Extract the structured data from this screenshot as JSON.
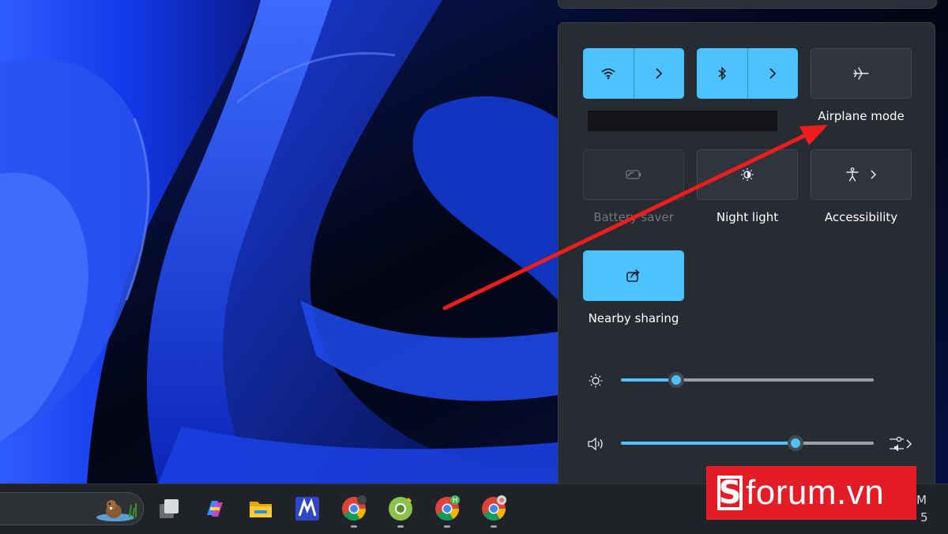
{
  "wallpaper": {
    "name": "windows-bloom-wallpaper"
  },
  "quick_settings": {
    "tiles": [
      {
        "id": "wifi",
        "label": "",
        "state": "on",
        "icon": "wifi-icon",
        "expand_icon": "chevron-right-icon"
      },
      {
        "id": "bluetooth",
        "label": "",
        "state": "on",
        "icon": "bluetooth-icon",
        "expand_icon": "chevron-right-icon"
      },
      {
        "id": "airplane",
        "label": "Airplane mode",
        "state": "off",
        "icon": "airplane-icon"
      },
      {
        "id": "battery",
        "label": "Battery saver",
        "state": "disabled",
        "icon": "battery-saver-icon"
      },
      {
        "id": "night",
        "label": "Night light",
        "state": "off",
        "icon": "night-light-icon"
      },
      {
        "id": "accessibility",
        "label": "Accessibility",
        "state": "off",
        "icon": "accessibility-icon",
        "expand_icon": "chevron-right-icon"
      },
      {
        "id": "nearby",
        "label": "Nearby sharing",
        "state": "on",
        "icon": "share-icon"
      }
    ],
    "brightness": {
      "icon": "brightness-icon",
      "level": 0.22
    },
    "volume": {
      "icon": "speaker-icon",
      "level": 0.69,
      "settings_icon": "audio-output-icon"
    },
    "accent_color": "#4cc2ff"
  },
  "annotation": {
    "type": "red-arrow",
    "color": "#ee1c1c",
    "points_to": "airplane"
  },
  "taskbar": {
    "apps": [
      "search-widget",
      "task-view",
      "copilot",
      "file-explorer",
      "app-m",
      "chrome-1",
      "chrome-2",
      "chrome-3",
      "chrome-4"
    ],
    "clock_time_fragment": "M",
    "clock_date_fragment": "5"
  },
  "brand": {
    "text": "forum.vn",
    "logo_letter": "S",
    "color": "#e31c25"
  }
}
